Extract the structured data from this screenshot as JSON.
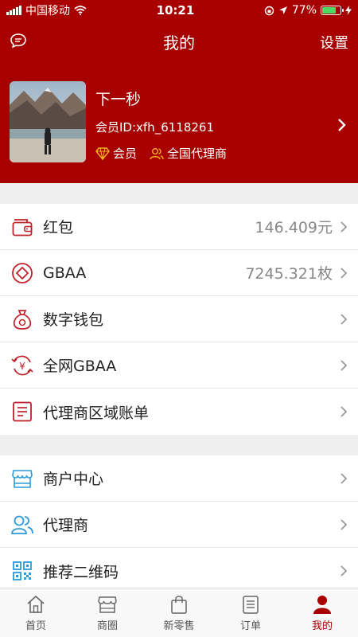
{
  "status_bar": {
    "carrier": "中国移动",
    "time": "10:21",
    "battery": "77%",
    "battery_level": 0.77
  },
  "header": {
    "title": "我的",
    "settings_label": "设置",
    "left_icon": "message-icon"
  },
  "profile": {
    "name": "下一秒",
    "member_id": "会员ID:xfh_6118261",
    "tags": [
      {
        "icon": "diamond-icon",
        "label": "会员"
      },
      {
        "icon": "users-icon",
        "label": "全国代理商"
      }
    ]
  },
  "menu_group_1": [
    {
      "icon": "wallet-icon",
      "label": "红包",
      "value": "146.409元"
    },
    {
      "icon": "diamond-coin-icon",
      "label": "GBAA",
      "value": "7245.321枚"
    },
    {
      "icon": "money-bag-icon",
      "label": "数字钱包",
      "value": ""
    },
    {
      "icon": "yuan-exchange-icon",
      "label": "全网GBAA",
      "value": ""
    },
    {
      "icon": "bill-icon",
      "label": "代理商区域账单",
      "value": ""
    }
  ],
  "menu_group_2": [
    {
      "icon": "store-icon",
      "label": "商户中心"
    },
    {
      "icon": "agents-icon",
      "label": "代理商"
    },
    {
      "icon": "qrcode-icon",
      "label": "推荐二维码"
    }
  ],
  "tabs": [
    {
      "icon": "home-icon",
      "label": "首页"
    },
    {
      "icon": "shop-icon",
      "label": "商圈"
    },
    {
      "icon": "bag-icon",
      "label": "新零售"
    },
    {
      "icon": "order-icon",
      "label": "订单"
    },
    {
      "icon": "person-icon",
      "label": "我的",
      "active": true
    }
  ],
  "colors": {
    "brand_red": "#a80000",
    "icon_red": "#c0202a",
    "icon_blue": "#2a9bd8"
  }
}
